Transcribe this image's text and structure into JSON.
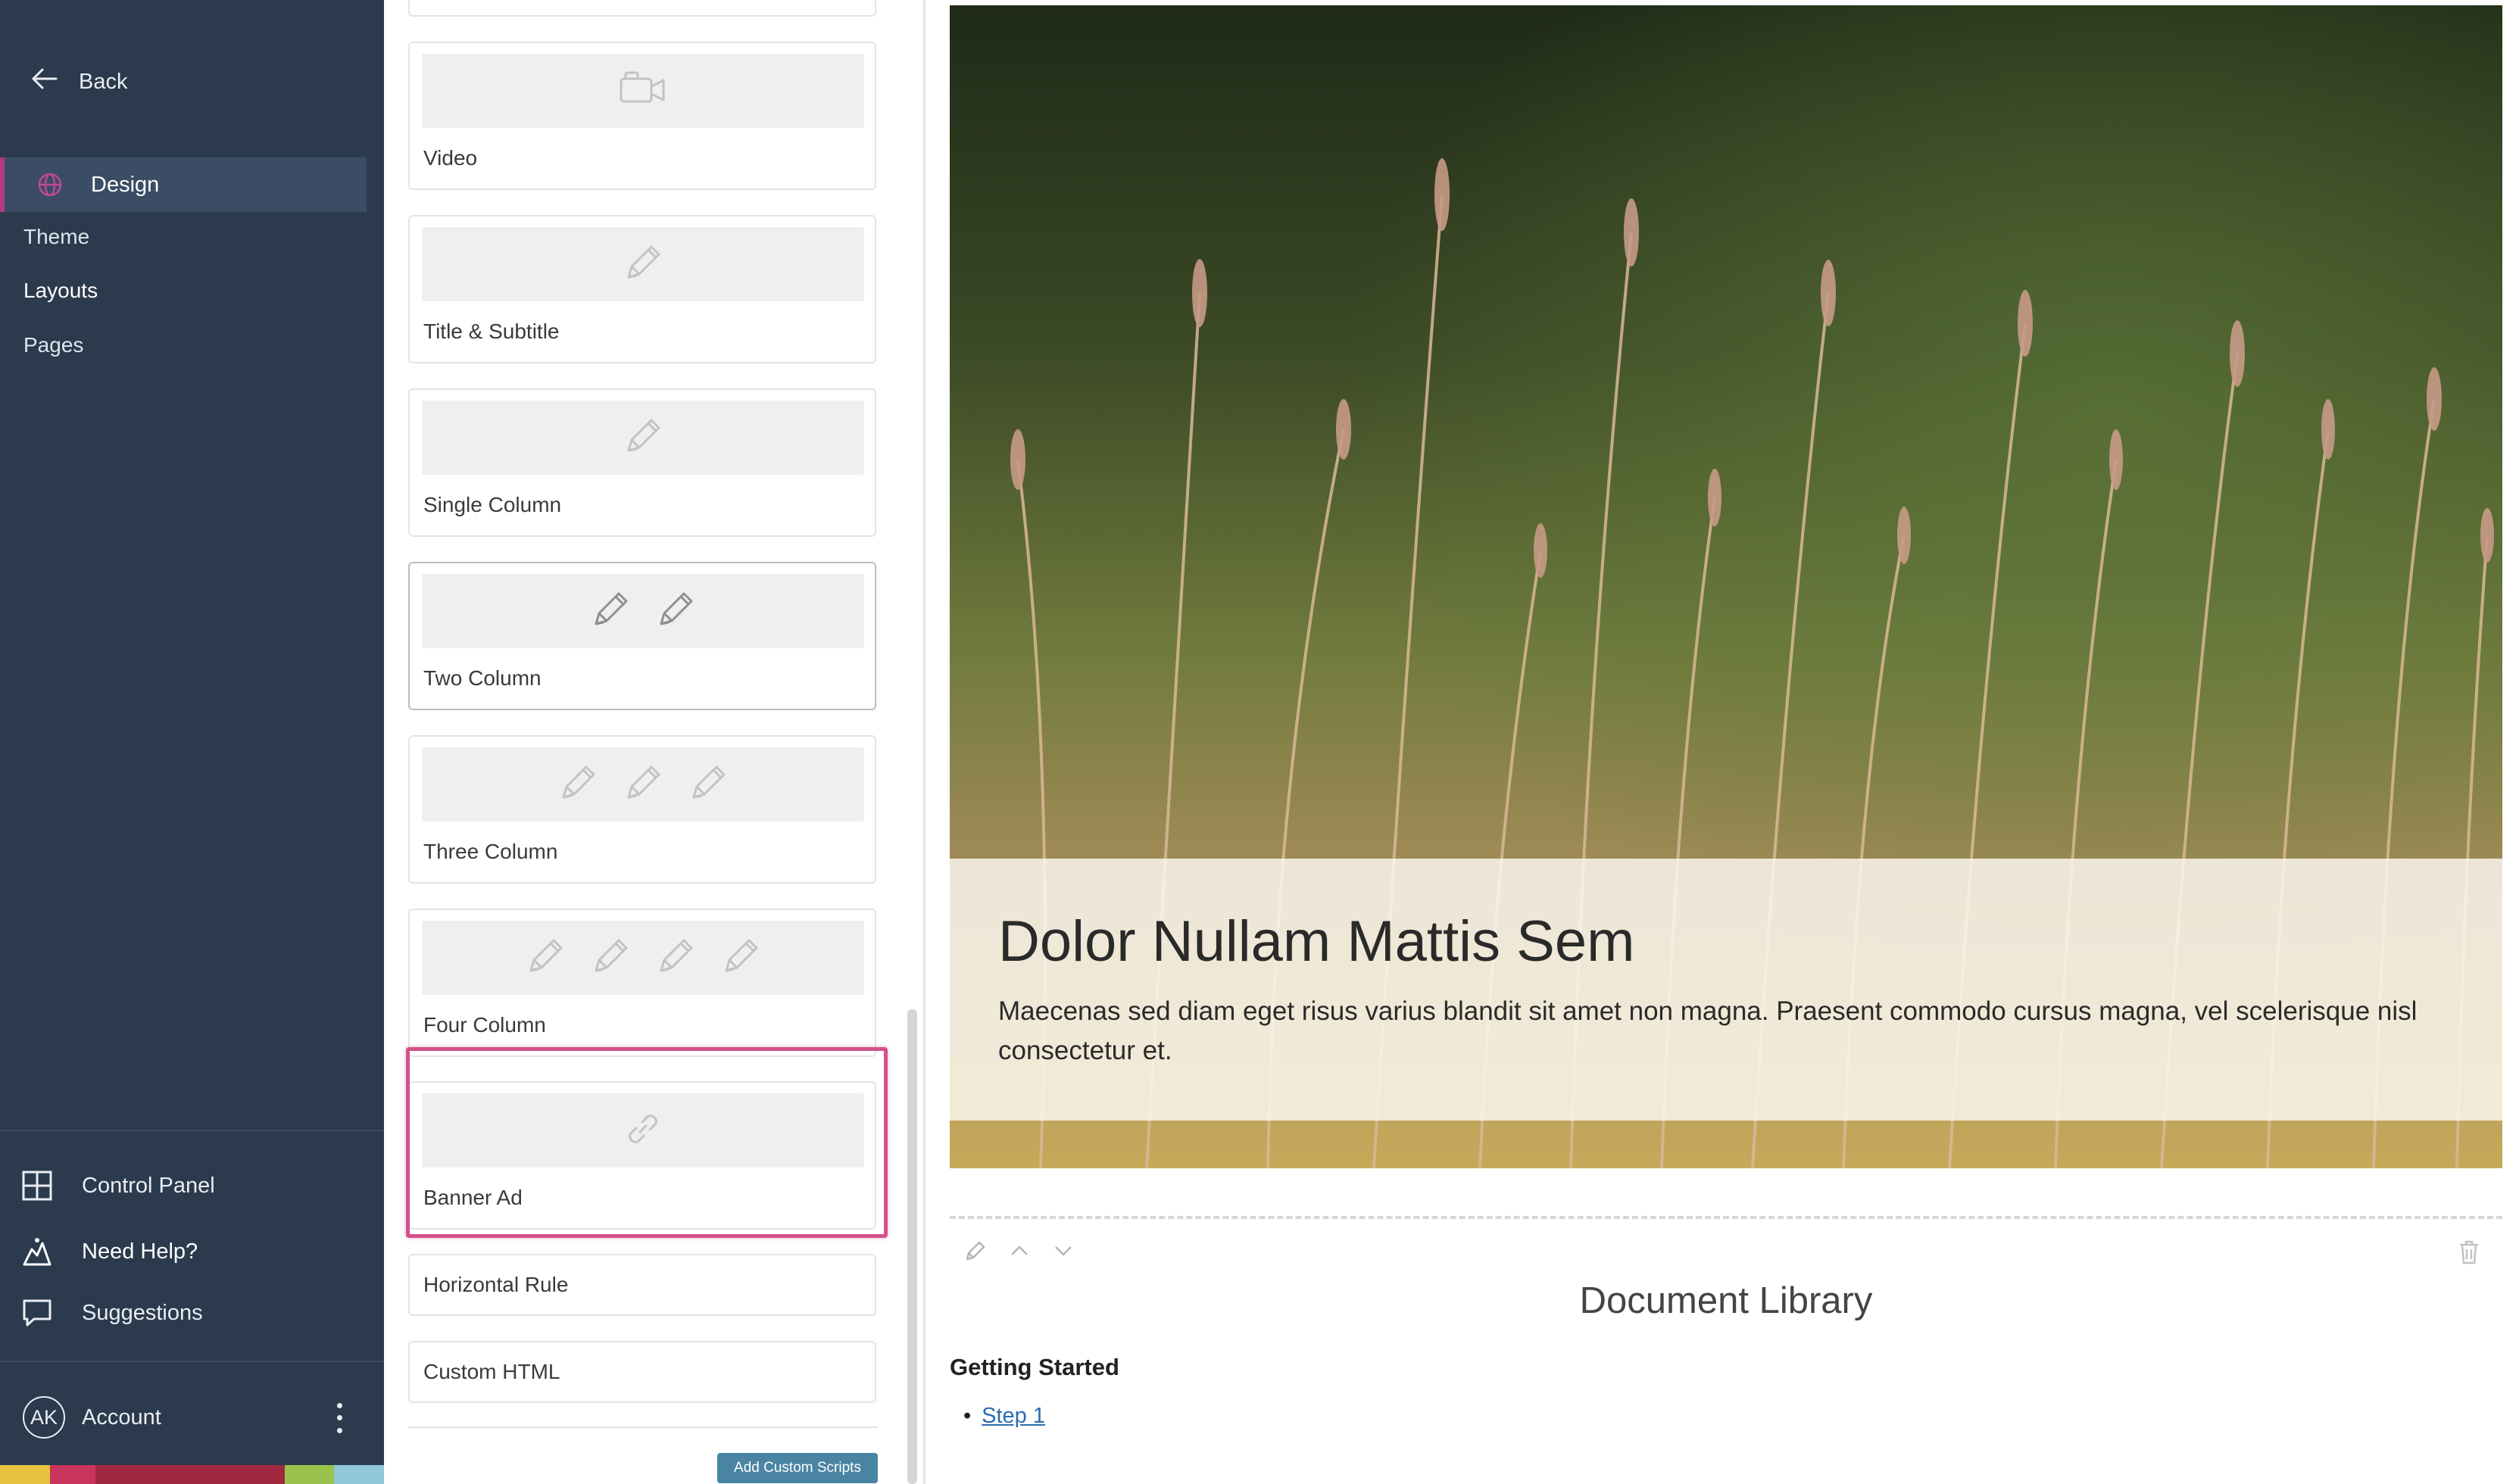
{
  "sidebar": {
    "back_label": "Back",
    "active_section": "Design",
    "sub_items": [
      {
        "label": "Theme",
        "active": false
      },
      {
        "label": "Layouts",
        "active": true
      },
      {
        "label": "Pages",
        "active": false
      }
    ],
    "bottom_items": [
      {
        "label": "Control Panel",
        "icon": "grid-icon"
      },
      {
        "label": "Need Help?",
        "icon": "help-icon"
      },
      {
        "label": "Suggestions",
        "icon": "chat-bubble-icon"
      }
    ],
    "account": {
      "initials": "AK",
      "label": "Account"
    },
    "colors": {
      "background": "#2b3a4d",
      "active_item": "#3b4d64",
      "accent": "#b03a86"
    }
  },
  "blocks": {
    "items": [
      {
        "label": "Video",
        "icon": "video-camera-icon"
      },
      {
        "label": "Title & Subtitle",
        "icon": "pencil-icon"
      },
      {
        "label": "Single Column",
        "icon": "pencil-icon"
      },
      {
        "label": "Two Column",
        "icon": "pencil-icon"
      },
      {
        "label": "Three Column",
        "icon": "pencil-icon"
      },
      {
        "label": "Four Column",
        "icon": "pencil-icon"
      },
      {
        "label": "Banner Ad",
        "icon": "link-icon",
        "highlighted": true
      },
      {
        "label": "Horizontal Rule"
      },
      {
        "label": "Custom HTML"
      }
    ],
    "add_scripts_label": "Add Custom Scripts",
    "highlight_color": "#d4508a"
  },
  "preview": {
    "hero": {
      "title": "Dolor Nullam Mattis Sem",
      "subtitle": "Maecenas sed diam eget risus varius blandit sit amet non magna. Praesent commodo cursus magna, vel scelerisque nisl consectetur et."
    },
    "document_library": {
      "title": "Document Library",
      "section": "Getting Started",
      "bullet": "•",
      "link": "Step 1"
    }
  }
}
